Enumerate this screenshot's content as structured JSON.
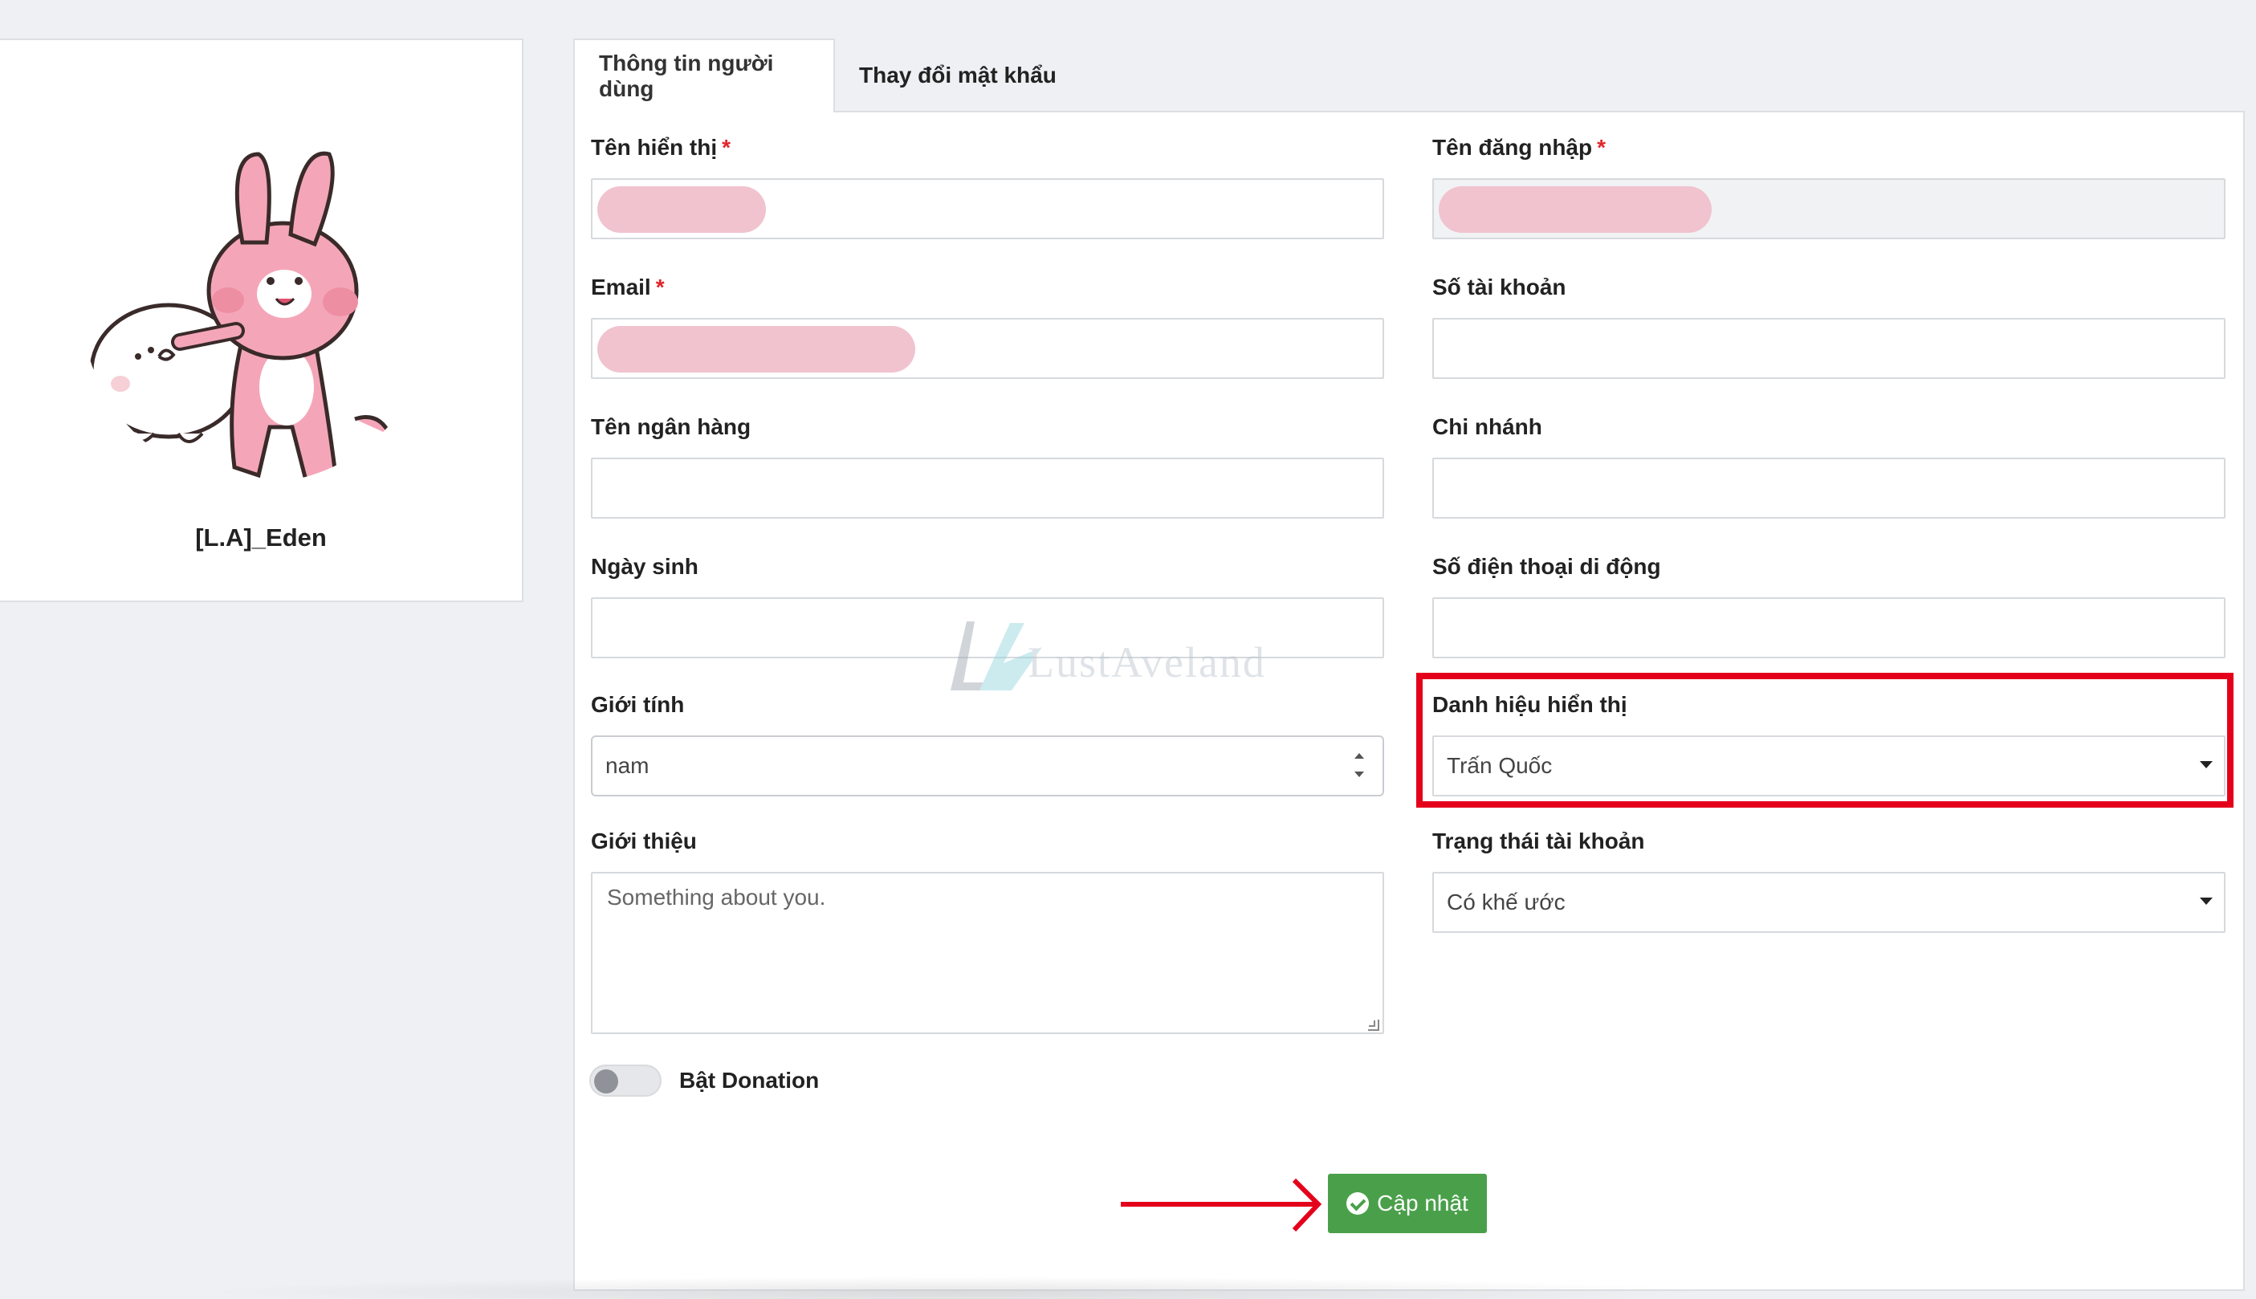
{
  "profile": {
    "username": "[L.A]_Eden"
  },
  "tabs": [
    {
      "label": "Thông tin người dùng",
      "active": true
    },
    {
      "label": "Thay đổi mật khẩu",
      "active": false
    }
  ],
  "form": {
    "display_name_label": "Tên hiển thị",
    "login_name_label": "Tên đăng nhập",
    "email_label": "Email",
    "account_number_label": "Số tài khoản",
    "bank_name_label": "Tên ngân hàng",
    "branch_label": "Chi nhánh",
    "birthday_label": "Ngày sinh",
    "mobile_label": "Số điện thoại di động",
    "gender_label": "Giới tính",
    "gender_value": "nam",
    "display_title_label": "Danh hiệu hiển thị",
    "display_title_value": "Trấn Quốc",
    "intro_label": "Giới thiệu",
    "intro_placeholder": "Something about you.",
    "account_status_label": "Trạng thái tài khoản",
    "account_status_value": "Có khế ước",
    "donation_label": "Bật Donation",
    "donation_enabled": false,
    "required_mark": "*",
    "submit_label": "Cập nhật"
  },
  "watermark": {
    "text": "LustAveland"
  },
  "colors": {
    "submit": "#4aa04a",
    "highlight": "#e4001b",
    "required": "#e0252b",
    "redacted": "#f0c3cf"
  }
}
